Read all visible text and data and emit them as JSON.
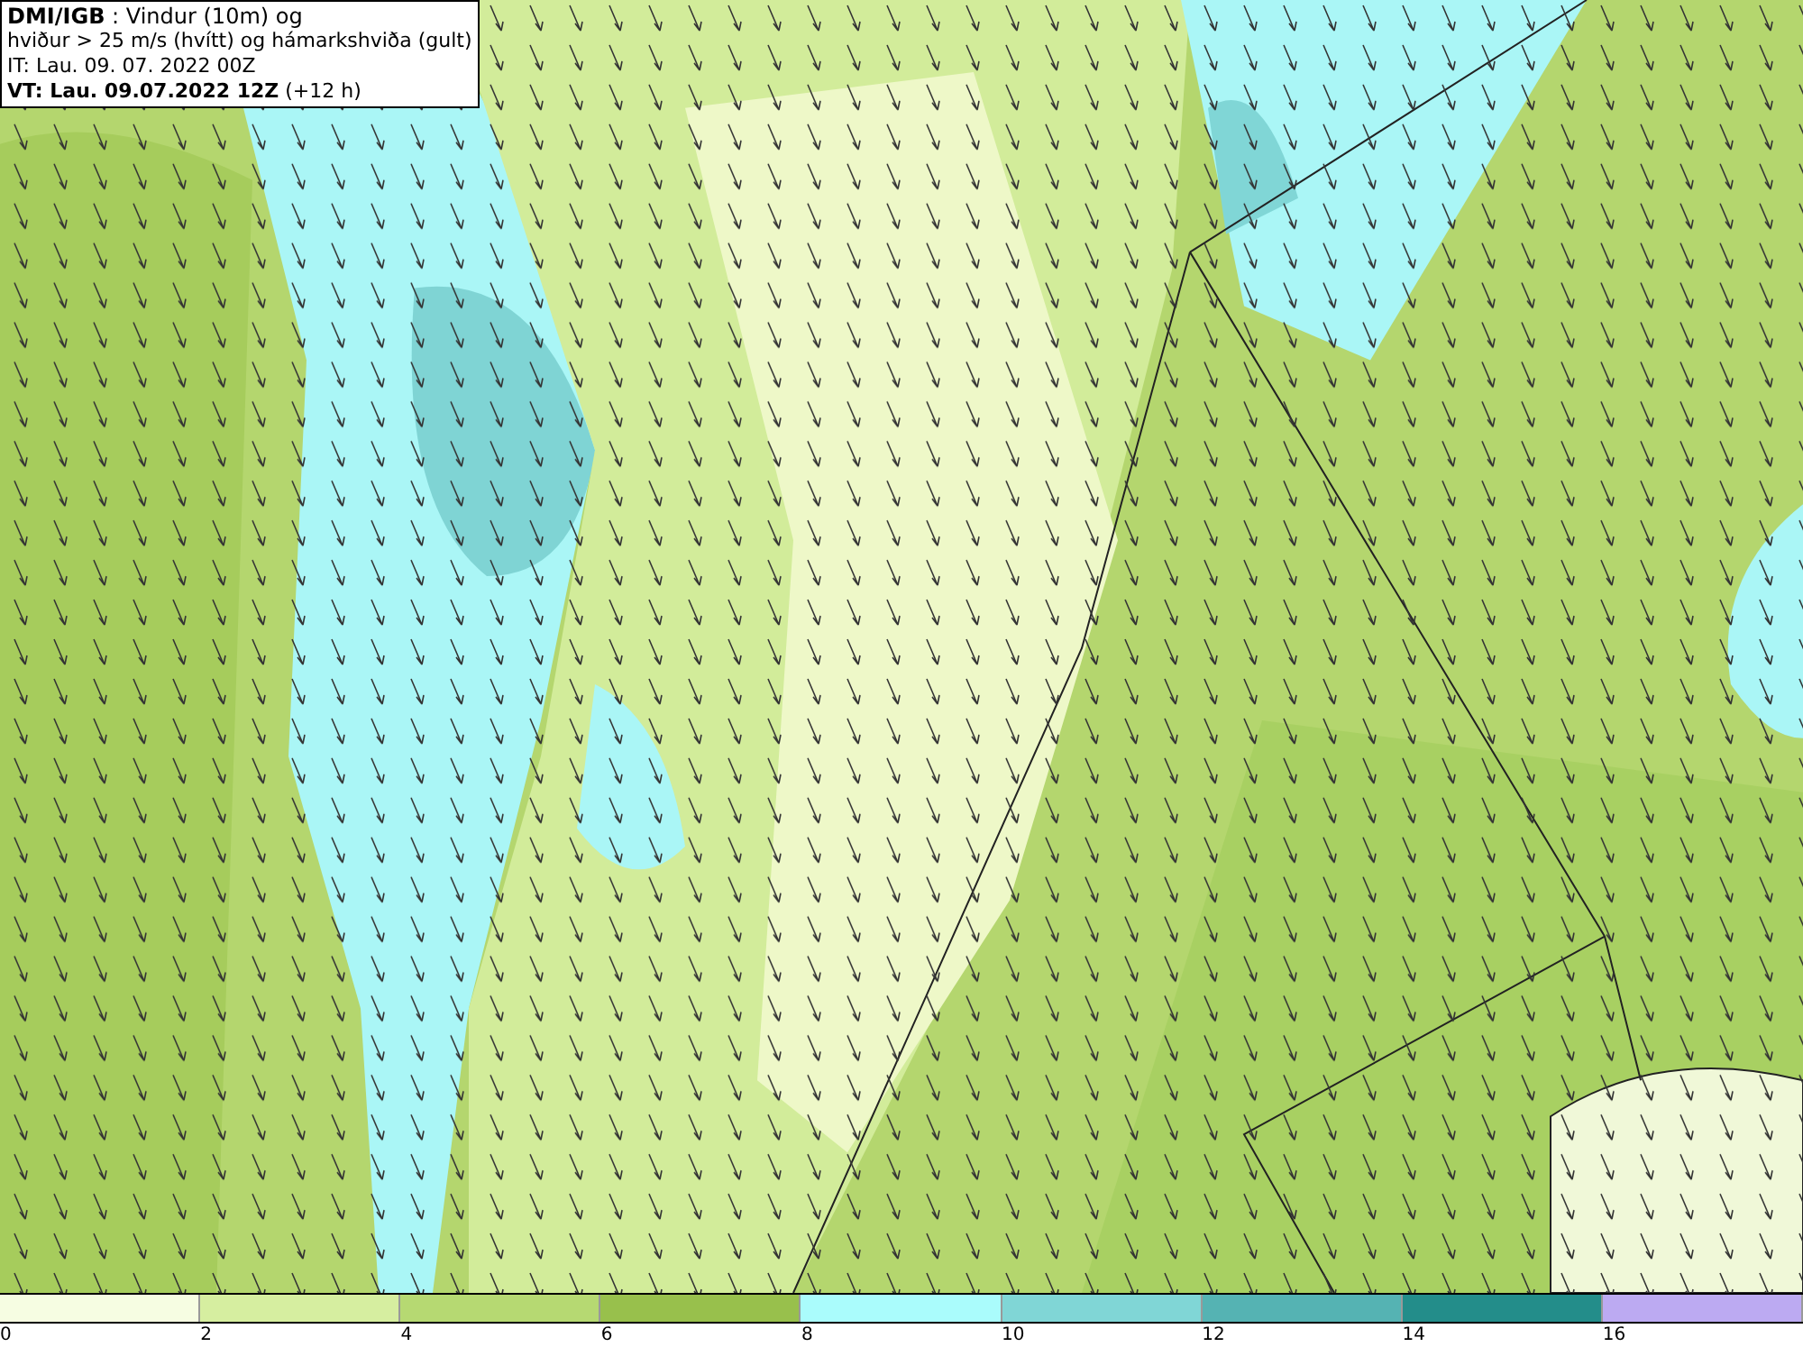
{
  "info_box": {
    "lines": [
      "**DMI/IGB** : Vindur (10m) og",
      "hviður > 25 m/s (hvítt) og hámarkshviða (gult)",
      "IT: Lau. 09. 07. 2022 00Z",
      "**VT: Lau. 09.07.2022 12Z** (+12 h)"
    ]
  },
  "legend": {
    "bins": [
      {
        "color": "#f6fde2",
        "label": "0"
      },
      {
        "color": "#d6eea0",
        "label": "2"
      },
      {
        "color": "#b6d972",
        "label": "4"
      },
      {
        "color": "#98c04c",
        "label": "6"
      },
      {
        "color": "#aafcfc",
        "label": "8"
      },
      {
        "color": "#80d6d6",
        "label": "10"
      },
      {
        "color": "#55b3b3",
        "label": "12"
      },
      {
        "color": "#238d8a",
        "label": "14"
      },
      {
        "color": "#bcaaf2",
        "label": "16"
      }
    ]
  }
}
